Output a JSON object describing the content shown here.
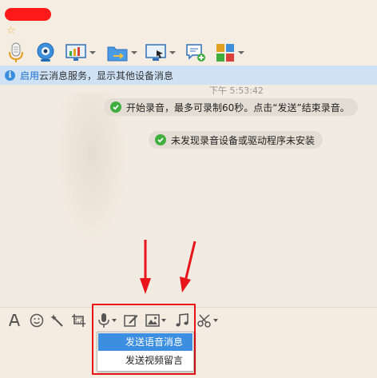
{
  "header": {
    "contact_name": "██████",
    "star_glyph": "☆"
  },
  "toolbar": {
    "items": [
      {
        "icon": "microphone-icon"
      },
      {
        "icon": "webcam-icon"
      },
      {
        "icon": "screen-share-icon"
      },
      {
        "icon": "folder-transfer-icon"
      },
      {
        "icon": "remote-desktop-icon"
      },
      {
        "icon": "message-add-icon"
      },
      {
        "icon": "apps-grid-icon"
      }
    ]
  },
  "info_bar": {
    "link_text": "启用",
    "text": "云消息服务，显示其他设备消息"
  },
  "chat": {
    "timestamp": "下午 5:53:42",
    "messages": [
      {
        "text": "开始录音，最多可录制60秒。点击“发送”结束录音。"
      },
      {
        "text": "未发现录音设备或驱动程序未安装"
      }
    ]
  },
  "input_toolbar": {
    "items": [
      {
        "icon": "font-icon"
      },
      {
        "icon": "emoji-icon"
      },
      {
        "icon": "magic-wand-icon"
      },
      {
        "icon": "screenshot-icon"
      },
      {
        "icon": "microphone-icon"
      },
      {
        "icon": "edit-icon"
      },
      {
        "icon": "image-icon"
      },
      {
        "icon": "music-icon"
      },
      {
        "icon": "scissors-icon"
      }
    ]
  },
  "voice_menu": {
    "items": [
      {
        "label": "发送语音消息",
        "selected": true
      },
      {
        "label": "发送视频留言",
        "selected": false
      }
    ]
  },
  "colors": {
    "accent": "#3b8ee0",
    "annotation_red": "#e8141a",
    "success_green": "#3fae3f",
    "info_bar_bg": "#cfe2f5"
  }
}
